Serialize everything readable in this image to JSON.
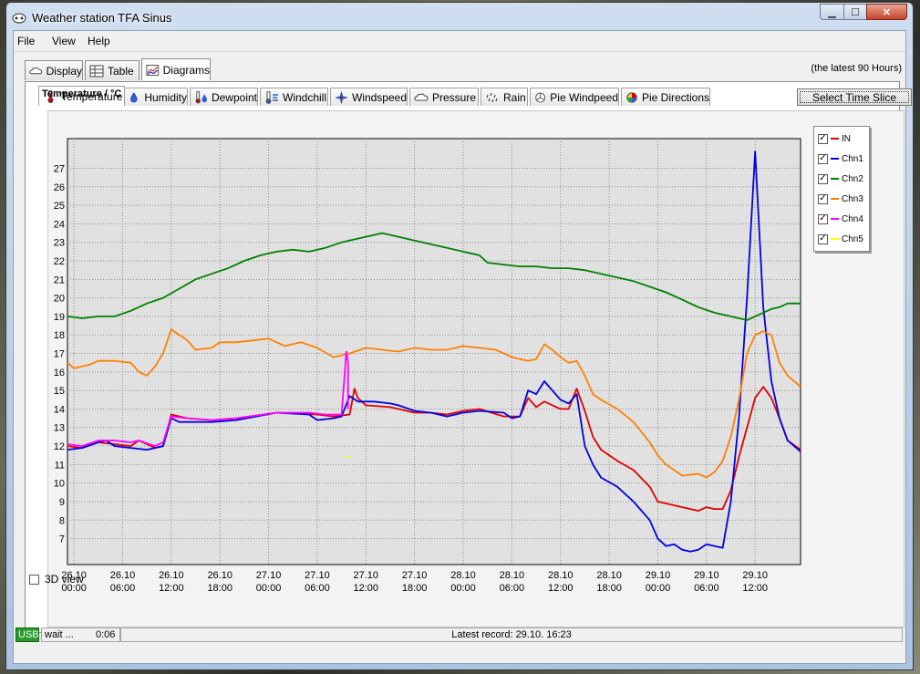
{
  "window": {
    "title": "Weather station TFA Sinus"
  },
  "menu": [
    "File",
    "View",
    "Help"
  ],
  "main_tabs": [
    {
      "label": "Display",
      "icon": "cloud-icon"
    },
    {
      "label": "Table",
      "icon": "table-icon"
    },
    {
      "label": "Diagrams",
      "icon": "diagram-icon"
    }
  ],
  "range_label": "(the latest 90 Hours)",
  "sub_tabs": [
    {
      "label": "Temperature",
      "icon": "thermometer-icon"
    },
    {
      "label": "Humidity",
      "icon": "humidity-icon"
    },
    {
      "label": "Dewpoint",
      "icon": "dewpoint-icon"
    },
    {
      "label": "Windchill",
      "icon": "windchill-icon"
    },
    {
      "label": "Windspeed",
      "icon": "windspeed-icon"
    },
    {
      "label": "Pressure",
      "icon": "pressure-icon"
    },
    {
      "label": "Rain",
      "icon": "rain-icon"
    },
    {
      "label": "Pie Windpeed",
      "icon": "pie-windspeed-icon"
    },
    {
      "label": "Pie Directions",
      "icon": "pie-directions-icon"
    }
  ],
  "select_time_slice": "Select Time Slice",
  "view_3d_label": "3D view",
  "status": {
    "usb": "USB",
    "state": "wait ...",
    "time": "0:06",
    "latest": "Latest record: 29.10. 16:23"
  },
  "chart_data": {
    "type": "line",
    "title": "Temperature / °C",
    "ylim": [
      5.6,
      28.6
    ],
    "xlim": [
      -0.8,
      89.6
    ],
    "y_ticks": [
      7,
      8,
      9,
      10,
      11,
      12,
      13,
      14,
      15,
      16,
      17,
      18,
      19,
      20,
      21,
      22,
      23,
      24,
      25,
      26,
      27
    ],
    "x_ticks": [
      {
        "h": 0,
        "date": "26.10",
        "time": "00:00"
      },
      {
        "h": 6,
        "date": "26.10",
        "time": "06:00"
      },
      {
        "h": 12,
        "date": "26.10",
        "time": "12:00"
      },
      {
        "h": 18,
        "date": "26.10",
        "time": "18:00"
      },
      {
        "h": 24,
        "date": "27.10",
        "time": "00:00"
      },
      {
        "h": 30,
        "date": "27.10",
        "time": "06:00"
      },
      {
        "h": 36,
        "date": "27.10",
        "time": "12:00"
      },
      {
        "h": 42,
        "date": "27.10",
        "time": "18:00"
      },
      {
        "h": 48,
        "date": "28.10",
        "time": "00:00"
      },
      {
        "h": 54,
        "date": "28.10",
        "time": "06:00"
      },
      {
        "h": 60,
        "date": "28.10",
        "time": "12:00"
      },
      {
        "h": 66,
        "date": "28.10",
        "time": "18:00"
      },
      {
        "h": 72,
        "date": "29.10",
        "time": "00:00"
      },
      {
        "h": 78,
        "date": "29.10",
        "time": "06:00"
      },
      {
        "h": 84,
        "date": "29.10",
        "time": "12:00"
      }
    ],
    "grid": true,
    "legend": "right",
    "series": [
      {
        "name": "IN",
        "color": "#e00000",
        "points": [
          [
            -0.8,
            12.0
          ],
          [
            1,
            11.9
          ],
          [
            3,
            12.2
          ],
          [
            5,
            12.1
          ],
          [
            7,
            12.0
          ],
          [
            8,
            12.3
          ],
          [
            10,
            11.9
          ],
          [
            11,
            12.0
          ],
          [
            12,
            13.7
          ],
          [
            14,
            13.5
          ],
          [
            17,
            13.4
          ],
          [
            20,
            13.5
          ],
          [
            25,
            13.8
          ],
          [
            30,
            13.7
          ],
          [
            32,
            13.6
          ],
          [
            34,
            13.7
          ],
          [
            34.6,
            15.1
          ],
          [
            35,
            14.6
          ],
          [
            36,
            14.2
          ],
          [
            39,
            14.1
          ],
          [
            42,
            13.8
          ],
          [
            44,
            13.8
          ],
          [
            46,
            13.7
          ],
          [
            48,
            13.9
          ],
          [
            50,
            14.0
          ],
          [
            53,
            13.6
          ],
          [
            55,
            13.6
          ],
          [
            56,
            14.6
          ],
          [
            57,
            14.1
          ],
          [
            58,
            14.4
          ],
          [
            60,
            14.0
          ],
          [
            61,
            14.0
          ],
          [
            62,
            15.1
          ],
          [
            63,
            13.9
          ],
          [
            64,
            12.5
          ],
          [
            65,
            11.8
          ],
          [
            67,
            11.2
          ],
          [
            69,
            10.7
          ],
          [
            71,
            9.8
          ],
          [
            72,
            9.0
          ],
          [
            73,
            8.9
          ],
          [
            75,
            8.7
          ],
          [
            77,
            8.5
          ],
          [
            78,
            8.7
          ],
          [
            79,
            8.6
          ],
          [
            80,
            8.6
          ],
          [
            81,
            9.6
          ],
          [
            82,
            11.4
          ],
          [
            83,
            13.0
          ],
          [
            84,
            14.6
          ],
          [
            85,
            15.2
          ],
          [
            86,
            14.6
          ],
          [
            87,
            13.5
          ],
          [
            88,
            12.3
          ],
          [
            89.6,
            11.8
          ]
        ]
      },
      {
        "name": "Chn1",
        "color": "#0000e0",
        "points": [
          [
            -0.8,
            11.8
          ],
          [
            1,
            11.9
          ],
          [
            3,
            12.2
          ],
          [
            4,
            12.3
          ],
          [
            5,
            12.0
          ],
          [
            7,
            11.9
          ],
          [
            9,
            11.8
          ],
          [
            11,
            12.0
          ],
          [
            12,
            13.5
          ],
          [
            13,
            13.3
          ],
          [
            17,
            13.3
          ],
          [
            20,
            13.4
          ],
          [
            25,
            13.8
          ],
          [
            29,
            13.7
          ],
          [
            30,
            13.4
          ],
          [
            32,
            13.5
          ],
          [
            33,
            13.6
          ],
          [
            34,
            14.7
          ],
          [
            35,
            14.4
          ],
          [
            37,
            14.4
          ],
          [
            39,
            14.3
          ],
          [
            40,
            14.2
          ],
          [
            42,
            13.9
          ],
          [
            44,
            13.8
          ],
          [
            46,
            13.6
          ],
          [
            48,
            13.8
          ],
          [
            50,
            13.9
          ],
          [
            53,
            13.8
          ],
          [
            54,
            13.5
          ],
          [
            55,
            13.6
          ],
          [
            56,
            15.0
          ],
          [
            57,
            14.8
          ],
          [
            58,
            15.5
          ],
          [
            59,
            15.0
          ],
          [
            60,
            14.5
          ],
          [
            61,
            14.3
          ],
          [
            62,
            14.8
          ],
          [
            63,
            12.0
          ],
          [
            64,
            11.0
          ],
          [
            65,
            10.3
          ],
          [
            67,
            9.8
          ],
          [
            69,
            9.0
          ],
          [
            71,
            8.0
          ],
          [
            72,
            7.0
          ],
          [
            73,
            6.6
          ],
          [
            74,
            6.7
          ],
          [
            75,
            6.4
          ],
          [
            76,
            6.3
          ],
          [
            77,
            6.4
          ],
          [
            78,
            6.7
          ],
          [
            79,
            6.6
          ],
          [
            80,
            6.5
          ],
          [
            81,
            9.0
          ],
          [
            82,
            13.5
          ],
          [
            83,
            20.0
          ],
          [
            84,
            27.9
          ],
          [
            85,
            19.5
          ],
          [
            86,
            15.5
          ],
          [
            87,
            13.5
          ],
          [
            88,
            12.3
          ],
          [
            89.6,
            11.7
          ]
        ]
      },
      {
        "name": "Chn2",
        "color": "#008000",
        "points": [
          [
            -0.8,
            19.0
          ],
          [
            1,
            18.9
          ],
          [
            3,
            19.0
          ],
          [
            5,
            19.0
          ],
          [
            7,
            19.3
          ],
          [
            9,
            19.7
          ],
          [
            11,
            20.0
          ],
          [
            13,
            20.5
          ],
          [
            15,
            21.0
          ],
          [
            17,
            21.3
          ],
          [
            19,
            21.6
          ],
          [
            21,
            22.0
          ],
          [
            23,
            22.3
          ],
          [
            25,
            22.5
          ],
          [
            27,
            22.6
          ],
          [
            29,
            22.5
          ],
          [
            31,
            22.7
          ],
          [
            33,
            23.0
          ],
          [
            35,
            23.2
          ],
          [
            37,
            23.4
          ],
          [
            38,
            23.5
          ],
          [
            40,
            23.3
          ],
          [
            42,
            23.1
          ],
          [
            44,
            22.9
          ],
          [
            46,
            22.7
          ],
          [
            48,
            22.5
          ],
          [
            50,
            22.3
          ],
          [
            51,
            21.9
          ],
          [
            53,
            21.8
          ],
          [
            55,
            21.7
          ],
          [
            57,
            21.7
          ],
          [
            59,
            21.6
          ],
          [
            61,
            21.6
          ],
          [
            63,
            21.5
          ],
          [
            65,
            21.3
          ],
          [
            67,
            21.1
          ],
          [
            69,
            20.9
          ],
          [
            71,
            20.6
          ],
          [
            73,
            20.3
          ],
          [
            75,
            19.9
          ],
          [
            77,
            19.5
          ],
          [
            79,
            19.2
          ],
          [
            81,
            19.0
          ],
          [
            83,
            18.8
          ],
          [
            84,
            19.0
          ],
          [
            85,
            19.2
          ],
          [
            86,
            19.4
          ],
          [
            87,
            19.5
          ],
          [
            88,
            19.7
          ],
          [
            89.6,
            19.7
          ]
        ]
      },
      {
        "name": "Chn3",
        "color": "#ff8000",
        "points": [
          [
            -0.8,
            16.5
          ],
          [
            0,
            16.2
          ],
          [
            2,
            16.4
          ],
          [
            3,
            16.6
          ],
          [
            5,
            16.6
          ],
          [
            7,
            16.5
          ],
          [
            8,
            16.0
          ],
          [
            9,
            15.8
          ],
          [
            10,
            16.3
          ],
          [
            11,
            17.0
          ],
          [
            12,
            18.3
          ],
          [
            13,
            18.0
          ],
          [
            14,
            17.7
          ],
          [
            15,
            17.2
          ],
          [
            17,
            17.3
          ],
          [
            18,
            17.6
          ],
          [
            20,
            17.6
          ],
          [
            22,
            17.7
          ],
          [
            24,
            17.8
          ],
          [
            26,
            17.4
          ],
          [
            28,
            17.6
          ],
          [
            30,
            17.3
          ],
          [
            32,
            16.8
          ],
          [
            34,
            17.0
          ],
          [
            36,
            17.3
          ],
          [
            38,
            17.2
          ],
          [
            40,
            17.1
          ],
          [
            42,
            17.3
          ],
          [
            44,
            17.2
          ],
          [
            46,
            17.2
          ],
          [
            48,
            17.4
          ],
          [
            50,
            17.3
          ],
          [
            52,
            17.2
          ],
          [
            54,
            16.8
          ],
          [
            56,
            16.6
          ],
          [
            57,
            16.7
          ],
          [
            58,
            17.5
          ],
          [
            59,
            17.2
          ],
          [
            60,
            16.8
          ],
          [
            61,
            16.5
          ],
          [
            62,
            16.6
          ],
          [
            63,
            15.8
          ],
          [
            64,
            14.8
          ],
          [
            65,
            14.5
          ],
          [
            67,
            14.0
          ],
          [
            69,
            13.3
          ],
          [
            71,
            12.2
          ],
          [
            72,
            11.5
          ],
          [
            73,
            11.0
          ],
          [
            74,
            10.7
          ],
          [
            75,
            10.4
          ],
          [
            77,
            10.5
          ],
          [
            78,
            10.3
          ],
          [
            79,
            10.6
          ],
          [
            80,
            11.2
          ],
          [
            81,
            12.5
          ],
          [
            82,
            14.5
          ],
          [
            83,
            17.0
          ],
          [
            84,
            18.0
          ],
          [
            85,
            18.2
          ],
          [
            86,
            18.0
          ],
          [
            87,
            16.5
          ],
          [
            88,
            15.8
          ],
          [
            89.6,
            15.2
          ]
        ]
      },
      {
        "name": "Chn4",
        "color": "#ff00ff",
        "points": [
          [
            -0.8,
            12.1
          ],
          [
            1,
            12.0
          ],
          [
            3,
            12.3
          ],
          [
            5,
            12.3
          ],
          [
            7,
            12.2
          ],
          [
            8,
            12.3
          ],
          [
            10,
            12.0
          ],
          [
            11,
            12.2
          ],
          [
            12,
            13.6
          ],
          [
            14,
            13.5
          ],
          [
            17,
            13.4
          ],
          [
            20,
            13.5
          ],
          [
            25,
            13.8
          ],
          [
            29,
            13.8
          ],
          [
            31,
            13.7
          ],
          [
            33,
            13.7
          ],
          [
            33.6,
            17.1
          ],
          [
            33.8,
            16.5
          ],
          [
            33.8,
            14.0
          ]
        ]
      },
      {
        "name": "Chn5",
        "color": "#ffff00",
        "points": [
          [
            33.6,
            11.4
          ],
          [
            34.0,
            11.4
          ]
        ]
      }
    ]
  }
}
